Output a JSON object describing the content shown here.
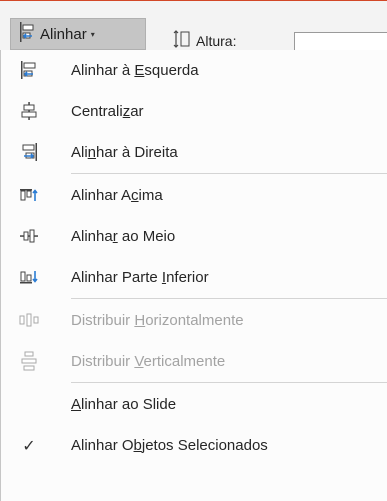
{
  "ribbon": {
    "align_button": {
      "label": "Alinhar",
      "caret": "▾"
    },
    "height_label": "Altura:"
  },
  "menu": {
    "items": [
      {
        "pre": "Alinhar à ",
        "key": "E",
        "post": "squerda",
        "icon": "align-left-icon",
        "enabled": true
      },
      {
        "pre": "Centrali",
        "key": "z",
        "post": "ar",
        "icon": "align-center-icon",
        "enabled": true
      },
      {
        "pre": "Ali",
        "key": "n",
        "post": "har à Direita",
        "icon": "align-right-icon",
        "enabled": true
      },
      {
        "pre": "Alinhar A",
        "key": "c",
        "post": "ima",
        "icon": "align-top-icon",
        "enabled": true
      },
      {
        "pre": "Alinha",
        "key": "r",
        "post": " ao Meio",
        "icon": "align-middle-icon",
        "enabled": true
      },
      {
        "pre": "Alinhar Parte ",
        "key": "I",
        "post": "nferior",
        "icon": "align-bottom-icon",
        "enabled": true
      },
      {
        "pre": "Distribuir ",
        "key": "H",
        "post": "orizontalmente",
        "icon": "distribute-horizontal-icon",
        "enabled": false
      },
      {
        "pre": "Distribuir ",
        "key": "V",
        "post": "erticalmente",
        "icon": "distribute-vertical-icon",
        "enabled": false
      },
      {
        "pre": "",
        "key": "A",
        "post": "linhar ao Slide",
        "icon": "",
        "enabled": true
      },
      {
        "pre": "Alinhar O",
        "key": "b",
        "post": "jetos Selecionados",
        "icon": "checkmark-icon",
        "enabled": true,
        "checked": true
      }
    ],
    "check_glyph": "✓"
  },
  "colors": {
    "accent": "#d24726",
    "icon_blue": "#2b7cd3",
    "disabled": "#a3a3a3"
  }
}
